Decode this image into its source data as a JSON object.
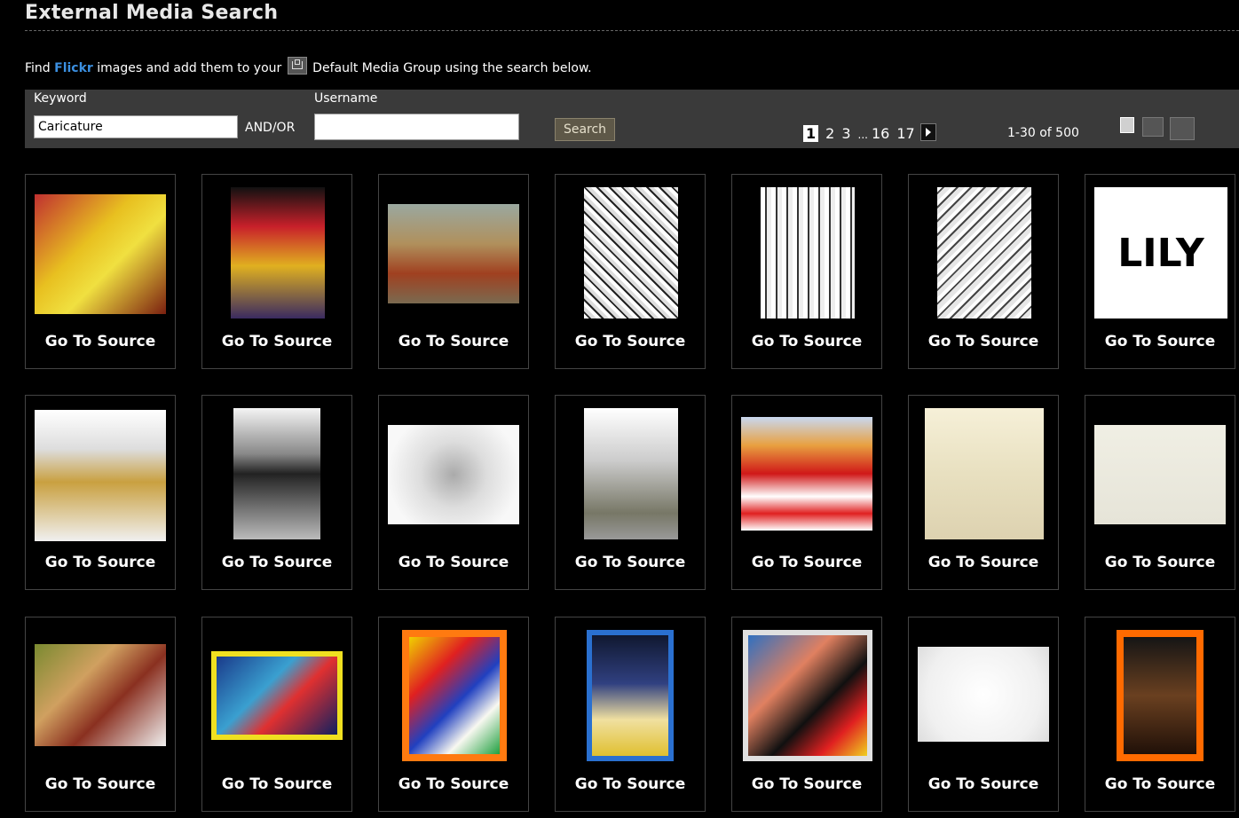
{
  "page": {
    "title": "External Media Search",
    "desc": {
      "prefix": "Find ",
      "link": "Flickr",
      "middle": " images and add them to your ",
      "suffix": " Default Media Group using the search below."
    }
  },
  "search": {
    "keyword_label": "Keyword",
    "keyword_value": "Caricature",
    "andor": "AND/OR",
    "username_label": "Username",
    "username_value": "",
    "button_label": "Search"
  },
  "pager": {
    "pages": [
      "1",
      "2",
      "3",
      "...",
      "16",
      "17"
    ],
    "current": "1",
    "range": "1-30 of 500"
  },
  "colors": {
    "background": "#000000",
    "bar": "#3a3a3a",
    "link": "#3b8fe0"
  },
  "results": {
    "link_label": "Go To Source",
    "items": [
      {
        "thumb": {
          "fill": "linear-gradient(135deg,#c03030 0%,#e8c020 40%,#f0e040 60%,#7a1f10 100%)",
          "border": "none"
        }
      },
      {
        "thumb": {
          "fill": "linear-gradient(180deg,#111 0%,#c8202a 30%,#e0b020 60%,#3a2a60 100%)",
          "border": "none"
        }
      },
      {
        "thumb": {
          "fill": "linear-gradient(180deg,#9aa8a0 0%,#b0905c 40%,#a04020 70%,#7a6a50 100%)",
          "border": "none"
        }
      },
      {
        "thumb": {
          "fill": "repeating-linear-gradient(45deg,#fff 0 4px,#222 4px 6px,#ddd 6px 10px)",
          "border": "none"
        }
      },
      {
        "thumb": {
          "fill": "repeating-linear-gradient(90deg,#fff 0 5px,#333 5px 7px,#eee 7px 12px)",
          "border": "none"
        }
      },
      {
        "thumb": {
          "fill": "repeating-linear-gradient(135deg,#fff 0 4px,#444 4px 6px,#e6e6e6 6px 11px)",
          "border": "none"
        }
      },
      {
        "thumb": {
          "fill": "#ffffff",
          "border": "none",
          "text": "LILY"
        }
      },
      {
        "thumb": {
          "fill": "linear-gradient(180deg,#fff 0%,#ddd 30%,#c9a040 55%,#f0f0f0 100%)",
          "border": "none"
        }
      },
      {
        "thumb": {
          "fill": "linear-gradient(180deg,#f4f4f4 0%,#888 35%,#222 50%,#bbb 100%)",
          "border": "none"
        }
      },
      {
        "thumb": {
          "fill": "radial-gradient(circle,#aaa 0%,#ddd 40%,#f8f8f8 80%)",
          "border": "none"
        }
      },
      {
        "thumb": {
          "fill": "linear-gradient(180deg,#fff 0%,#ccc 40%,#776 80%,#999 100%)",
          "border": "none"
        }
      },
      {
        "thumb": {
          "fill": "linear-gradient(180deg,#c8d8f0 0%,#e8a040 25%,#d01818 50%,#fff 70%,#e02020 85%,#fff 100%)",
          "border": "none"
        }
      },
      {
        "thumb": {
          "fill": "linear-gradient(180deg,#f6f0d8 0%,#e8e0c0 50%,#ddd2b0 100%)",
          "border": "none"
        }
      },
      {
        "thumb": {
          "fill": "linear-gradient(180deg,#f0efe4 0%,#e6e4d8 100%)",
          "border": "none"
        }
      },
      {
        "thumb": {
          "fill": "linear-gradient(135deg,#7a8a30 0%,#d0a060 35%,#8a3020 60%,#f0f0f0 100%)",
          "border": "none"
        }
      },
      {
        "thumb": {
          "fill": "linear-gradient(135deg,#1a3a8a 0%,#3aa0d0 40%,#e03030 60%,#102060 100%)",
          "border": "6px solid #f0e020"
        }
      },
      {
        "thumb": {
          "fill": "linear-gradient(135deg,#f0d000 0%,#e02020 30%,#2040c0 55%,#f8f8f0 75%,#20a040 100%)",
          "border": "8px solid #ff7a10"
        }
      },
      {
        "thumb": {
          "fill": "linear-gradient(180deg,#101830 0%,#304080 40%,#f0e0a0 70%,#e0c030 100%)",
          "border": "6px solid #2a70d0"
        }
      },
      {
        "thumb": {
          "fill": "linear-gradient(135deg,#3070c0 0%,#e08060 35%,#101010 60%,#e02020 80%,#f0d020 100%)",
          "border": "6px solid #e0e0e0"
        }
      },
      {
        "thumb": {
          "fill": "radial-gradient(circle,#fff 0%,#f0f0f0 70%,#ddd 100%)",
          "border": "none"
        }
      },
      {
        "thumb": {
          "fill": "linear-gradient(180deg,#151515 0%,#6a4020 50%,#201008 100%)",
          "border": "8px solid #ff6a00"
        }
      }
    ]
  }
}
